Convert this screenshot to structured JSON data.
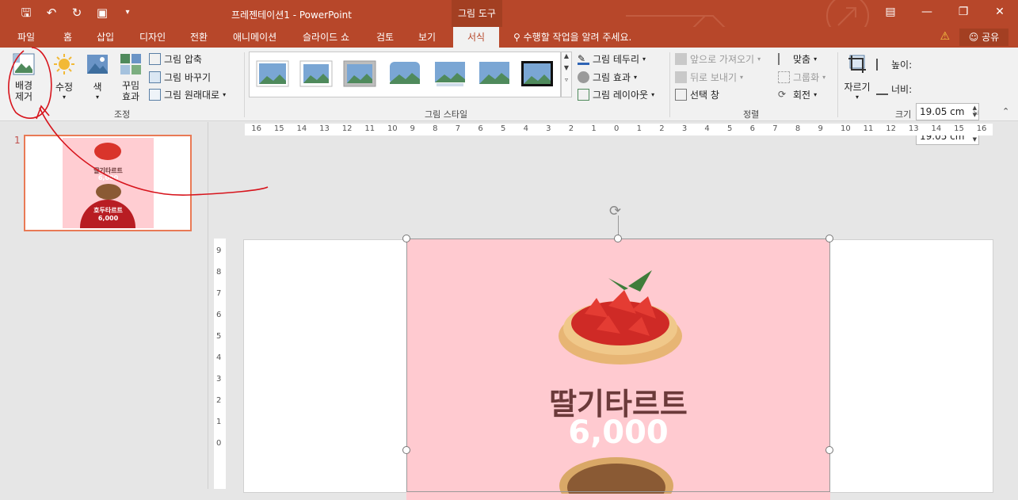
{
  "window": {
    "title": "프레젠테이션1 - PowerPoint",
    "context_tab_header": "그림 도구"
  },
  "tabs": [
    "파일",
    "홈",
    "삽입",
    "디자인",
    "전환",
    "애니메이션",
    "슬라이드 쇼",
    "검토",
    "보기",
    "서식"
  ],
  "active_tab": "서식",
  "tell_me": "수행할 작업을 알려 주세요.",
  "share_label": "공유",
  "ribbon": {
    "adjust": {
      "group_label": "조정",
      "remove_bg": "배경\n제거",
      "corrections": "수정",
      "color": "색",
      "artistic": "꾸밈\n효과",
      "compress": "그림 압축",
      "change": "그림 바꾸기",
      "reset": "그림 원래대로"
    },
    "styles": {
      "group_label": "그림 스타일",
      "border": "그림 테두리",
      "effects": "그림 효과",
      "layout": "그림 레이아웃"
    },
    "arrange": {
      "group_label": "정렬",
      "bring_forward": "앞으로 가져오기",
      "send_backward": "뒤로 보내기",
      "selection_pane": "선택 창",
      "align": "맞춤",
      "group": "그룹화",
      "rotate": "회전"
    },
    "size": {
      "group_label": "크기",
      "crop": "자르기",
      "height_label": "높이:",
      "height_value": "19.05 cm",
      "width_label": "너비:",
      "width_value": "19.05 cm"
    }
  },
  "thumbnail": {
    "number": "1",
    "text1": "딸기타르트",
    "price1": "6,000",
    "text2": "호두타르트",
    "price2": "6,000"
  },
  "ruler": {
    "h_ticks": [
      "16",
      "15",
      "14",
      "13",
      "12",
      "11",
      "10",
      "9",
      "8",
      "7",
      "6",
      "5",
      "4",
      "3",
      "2",
      "1",
      "0",
      "1",
      "2",
      "3",
      "4",
      "5",
      "6",
      "7",
      "8",
      "9",
      "10",
      "11",
      "12",
      "13",
      "14",
      "15",
      "16"
    ],
    "v_ticks": [
      "9",
      "8",
      "7",
      "6",
      "5",
      "4",
      "3",
      "2",
      "1",
      "0"
    ]
  },
  "slide": {
    "title": "딸기타르트",
    "price": "6,000"
  },
  "colors": {
    "accent": "#b7472a",
    "pink": "#ffcad0",
    "text_brown": "#6b3a3a"
  }
}
